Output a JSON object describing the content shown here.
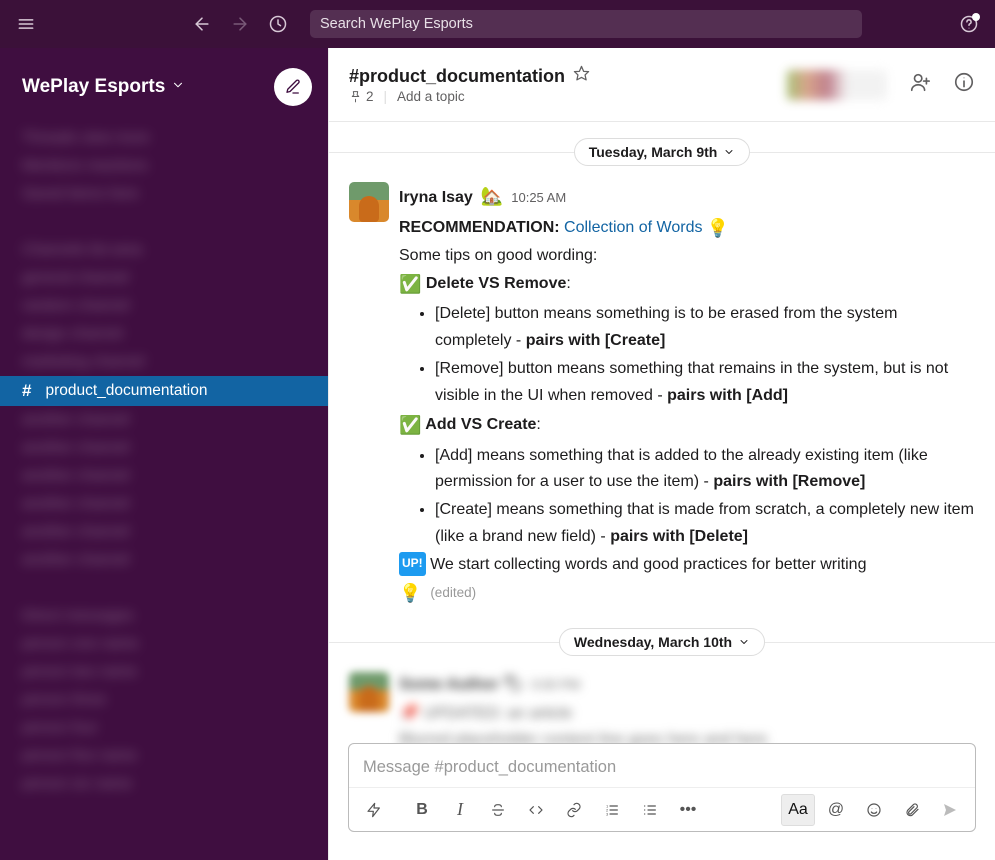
{
  "topbar": {
    "search_placeholder": "Search WePlay Esports"
  },
  "workspace": {
    "name": "WePlay Esports"
  },
  "sidebar": {
    "active_channel_hash": "#",
    "active_channel": "product_documentation"
  },
  "channel_header": {
    "title": "#product_documentation",
    "pin_count": "2",
    "topic_placeholder": "Add a topic"
  },
  "dates": {
    "day1": "Tuesday, March 9th",
    "day2": "Wednesday, March 10th"
  },
  "message": {
    "author": "Iryna Isay",
    "author_emoji": "🏡",
    "timestamp": "10:25 AM",
    "rec_label": "RECOMMENDATION: ",
    "rec_link": "Collection of Words",
    "bulb": "💡",
    "tips_line": "Some tips on good wording:",
    "check": "✅",
    "section1_title": " Delete VS Remove",
    "section1_colon": ":",
    "b1a_prefix": "[Delete] button means something is to be erased from the system completely - ",
    "b1a_bold": "pairs with [Create]",
    "b1b_prefix": "[Remove] button means something that remains in the system, but is not visible in the UI when removed - ",
    "b1b_bold": "pairs with [Add]",
    "section2_title": " Add VS Create",
    "section2_colon": ":",
    "b2a_prefix": "[Add] means something that is added to the already existing item (like permission for a user to use the item) - ",
    "b2a_bold": "pairs with [Remove]",
    "b2b_prefix": "[Create] means something that is made from scratch, a completely new item (like a brand new field) - ",
    "b2b_bold": "pairs with [Delete]",
    "up_badge": "UP!",
    "up_line": " We start collecting words and good practices for better writing ",
    "edited": "(edited)"
  },
  "composer": {
    "placeholder": "Message #product_documentation",
    "aa": "Aa"
  }
}
